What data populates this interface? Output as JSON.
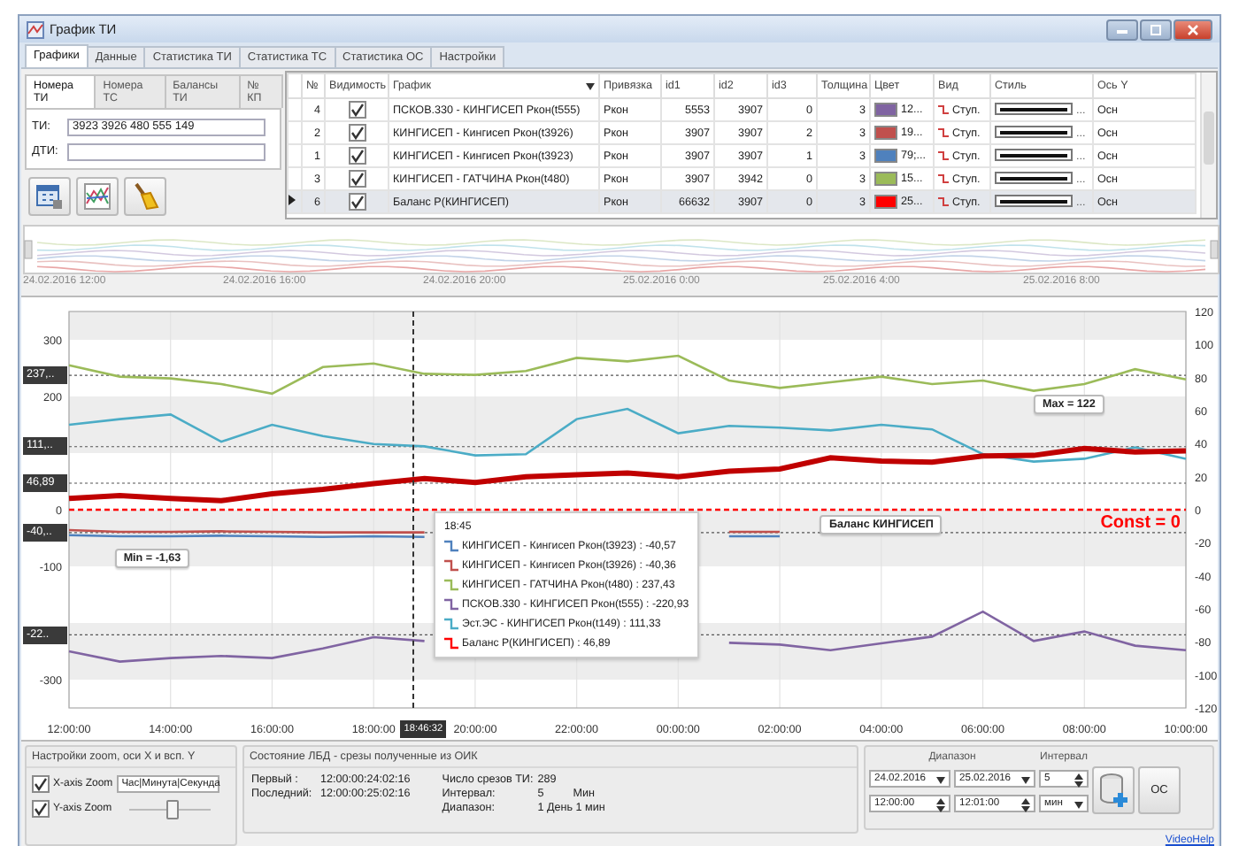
{
  "window": {
    "title": "График ТИ"
  },
  "tabs": [
    {
      "label": "Графики",
      "selected": true
    },
    {
      "label": "Данные",
      "selected": false
    },
    {
      "label": "Статистика ТИ",
      "selected": false
    },
    {
      "label": "Статистика ТС",
      "selected": false
    },
    {
      "label": "Статистика ОС",
      "selected": false
    },
    {
      "label": "Настройки",
      "selected": false
    }
  ],
  "left_panel": {
    "tabs": [
      {
        "label": "Номера ТИ",
        "selected": true
      },
      {
        "label": "Номера ТС",
        "selected": false
      },
      {
        "label": "Балансы ТИ",
        "selected": false
      },
      {
        "label": "№ КП",
        "selected": false
      }
    ],
    "fields": [
      {
        "label": "ТИ:",
        "value": "3923 3926 480 555 149"
      },
      {
        "label": "ДТИ:"
      }
    ]
  },
  "table": {
    "columns": [
      "№",
      "Видимость",
      "График",
      "Привязка",
      "id1",
      "id2",
      "id3",
      "Толщина",
      "Цвет",
      "Вид",
      "Стиль",
      "Ось Y"
    ],
    "rows": [
      {
        "n": "4",
        "visible": true,
        "graph": "ПСКОВ.330 - КИНГИСЕП Ркон(t555)",
        "binding": "Ркон",
        "id1": "5553",
        "id2": "3907",
        "id3": "0",
        "thickness": "3",
        "color": "#8064a2",
        "color_text": "12...",
        "view": "Ступ.",
        "style_more": "...",
        "axis": "Осн",
        "selected": false
      },
      {
        "n": "2",
        "visible": true,
        "graph": "КИНГИСЕП - Кингисеп Ркон(t3926)",
        "binding": "Ркон",
        "id1": "3907",
        "id2": "3907",
        "id3": "2",
        "thickness": "3",
        "color": "#c0504d",
        "color_text": "19...",
        "view": "Ступ.",
        "style_more": "...",
        "axis": "Осн",
        "selected": false
      },
      {
        "n": "1",
        "visible": true,
        "graph": "КИНГИСЕП - Кингисеп Ркон(t3923)",
        "binding": "Ркон",
        "id1": "3907",
        "id2": "3907",
        "id3": "1",
        "thickness": "3",
        "color": "#4f81bd",
        "color_text": "79;...",
        "view": "Ступ.",
        "style_more": "...",
        "axis": "Осн",
        "selected": false
      },
      {
        "n": "3",
        "visible": true,
        "graph": "КИНГИСЕП - ГАТЧИНА Ркон(t480)",
        "binding": "Ркон",
        "id1": "3907",
        "id2": "3942",
        "id3": "0",
        "thickness": "3",
        "color": "#9bbb59",
        "color_text": "15...",
        "view": "Ступ.",
        "style_more": "...",
        "axis": "Осн",
        "selected": false
      },
      {
        "n": "6",
        "visible": true,
        "graph": "Баланс Р(КИНГИСЕП)",
        "binding": "Ркон",
        "id1": "66632",
        "id2": "3907",
        "id3": "0",
        "thickness": "3",
        "color": "#ff0000",
        "color_text": "25...",
        "view": "Ступ.",
        "style_more": "...",
        "axis": "Осн",
        "selected": true
      }
    ]
  },
  "overview": {
    "date_labels": [
      "24.02.2016 12:00",
      "24.02.2016 16:00",
      "24.02.2016 20:00",
      "25.02.2016 0:00",
      "25.02.2016 4:00",
      "25.02.2016 8:00"
    ]
  },
  "chart": {
    "chart_data": {
      "type": "line",
      "categories": [
        "12:00:00",
        null,
        "14:00:00",
        null,
        "16:00:00",
        null,
        "18:00:00",
        null,
        "20:00:00",
        null,
        "22:00:00",
        null,
        "00:00:00",
        null,
        "02:00:00",
        null,
        "04:00:00",
        null,
        "06:00:00",
        null,
        "08:00:00",
        null,
        "10:00:00"
      ],
      "grid": true,
      "ylim": [
        -350,
        350
      ],
      "yticks": [
        -300,
        -100,
        0,
        200,
        300
      ],
      "series": [
        {
          "color": "#9bbb59",
          "values": [
            255,
            235,
            232,
            222,
            205,
            252,
            258,
            240,
            238,
            245,
            268,
            262,
            272,
            228,
            215,
            225,
            235,
            222,
            228,
            210,
            222,
            248,
            230
          ]
        },
        {
          "color": "#4bacc6",
          "values": [
            150,
            160,
            168,
            120,
            150,
            130,
            116,
            112,
            96,
            98,
            160,
            178,
            135,
            148,
            145,
            140,
            150,
            142,
            98,
            85,
            90,
            110,
            90
          ]
        },
        {
          "color": "#8064a2",
          "values": [
            -250,
            -268,
            -262,
            -258,
            -262,
            -245,
            -225,
            -232,
            null,
            null,
            null,
            null,
            null,
            -235,
            -238,
            -248,
            -236,
            -224,
            -180,
            -232,
            -215,
            -240,
            -248
          ]
        },
        {
          "color": "#4f81bd",
          "values": [
            -45,
            -47,
            -47,
            -46,
            -47,
            -48,
            -47,
            -48,
            null,
            null,
            null,
            null,
            null,
            -47,
            -47,
            null,
            null,
            null,
            null,
            null,
            null,
            null,
            null
          ]
        },
        {
          "color": "#c0504d",
          "values": [
            -36,
            -39,
            -39,
            -38,
            -39,
            -40,
            -40,
            -40,
            null,
            null,
            null,
            null,
            null,
            -39,
            -39,
            null,
            null,
            null,
            null,
            null,
            null,
            null,
            null
          ]
        },
        {
          "color": "#c00000",
          "values": [
            20,
            25,
            20,
            16,
            28,
            36,
            46,
            55,
            48,
            58,
            62,
            65,
            58,
            68,
            72,
            92,
            86,
            84,
            95,
            96,
            108,
            102,
            104
          ]
        }
      ],
      "ref_lines": [
        {
          "axis": "y",
          "value": 237.43
        },
        {
          "axis": "y",
          "value": 111.33
        },
        {
          "axis": "y",
          "value": 46.89
        },
        {
          "axis": "y",
          "value": -40.57
        },
        {
          "axis": "y",
          "value": -220.93
        },
        {
          "axis": "y",
          "value": 0,
          "label": "Const = 0",
          "color": "#ff0000"
        }
      ],
      "annotations": [
        "Max = 122",
        "Min = -1,63",
        "Баланс КИНГИСЕП"
      ]
    },
    "value_tags": [
      "237,..",
      "111,..",
      "46,89",
      "-40,..",
      "-22.."
    ],
    "cursor": {
      "label": "18:46:32"
    },
    "right_axis_ticks": [
      "120",
      "100",
      "80",
      "60",
      "40",
      "20",
      "0",
      "-20",
      "-40",
      "-60",
      "-80",
      "-100",
      "-120"
    ],
    "tooltip": {
      "title": "18:45",
      "items": [
        {
          "text": "КИНГИСЕП - Кингисеп Ркон(t3923) : -40,57",
          "color": "#4f81bd"
        },
        {
          "text": "КИНГИСЕП - Кингисеп Ркон(t3926) : -40,36",
          "color": "#c0504d"
        },
        {
          "text": "КИНГИСЕП - ГАТЧИНА Ркон(t480) : 237,43",
          "color": "#9bbb59"
        },
        {
          "text": "ПСКОВ.330 - КИНГИСЕП Ркон(t555) : -220,93",
          "color": "#8064a2"
        },
        {
          "text": "Эст.ЭС - КИНГИСЕП Ркон(t149) : 111,33",
          "color": "#4bacc6"
        },
        {
          "text": "Баланс Р(КИНГИСЕП) : 46,89",
          "color": "#ff0000"
        }
      ]
    }
  },
  "zoom_settings": {
    "title": "Настройки zoom, оси X и всп. Y",
    "x_zoom": {
      "label": "X-axis Zoom",
      "checked": true,
      "mode": "Час|Минута|Секунда"
    },
    "y_zoom": {
      "label": "Y-axis Zoom",
      "checked": true,
      "level": 0.5
    }
  },
  "state": {
    "title": "Состояние ЛБД - срезы полученные из ОИК",
    "rows": [
      {
        "label": "Первый :",
        "value": "12:00:00:24:02:16"
      },
      {
        "label": "Последний:",
        "value": "12:00:00:25:02:16"
      }
    ],
    "stats": [
      {
        "label": "Число срезов ТИ:",
        "value": "289"
      },
      {
        "label": "Интервал:",
        "value": "5",
        "unit": "Мин"
      },
      {
        "label": "Диапазон:",
        "value": "1 День 1 мин"
      }
    ]
  },
  "range": {
    "range_label": "Диапазон",
    "interval_label": "Интервал",
    "date_from": "24.02.2016",
    "date_to": "25.02.2016",
    "time_from": "12:00:00",
    "time_to": "12:01:00",
    "interval": "5",
    "unit": "мин",
    "button": "ОС"
  },
  "link": "VideoHelp"
}
